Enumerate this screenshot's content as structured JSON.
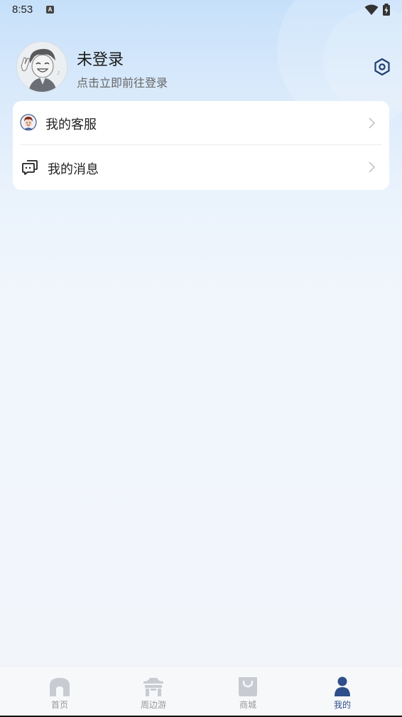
{
  "status_bar": {
    "time": "8:53",
    "notification_icon": "a-letter-icon",
    "wifi_icon": "wifi-icon",
    "battery_icon": "battery-charging-icon"
  },
  "profile": {
    "name": "未登录",
    "subtitle": "点击立即前往登录",
    "avatar_icon": "cartoon-avatar-icon",
    "settings_icon": "hexagon-settings-icon"
  },
  "menu": {
    "items": [
      {
        "label": "我的客服",
        "icon": "customer-service-avatar-icon"
      },
      {
        "label": "我的消息",
        "icon": "message-bubble-icon"
      }
    ]
  },
  "tabbar": {
    "items": [
      {
        "label": "首页",
        "icon": "home-icon",
        "active": false
      },
      {
        "label": "周边游",
        "icon": "pavilion-icon",
        "active": false
      },
      {
        "label": "商城",
        "icon": "shopping-bag-icon",
        "active": false
      },
      {
        "label": "我的",
        "icon": "person-icon",
        "active": true
      }
    ]
  },
  "colors": {
    "accent": "#2e4f8a",
    "inactive": "#c8ccd2",
    "header_gradient_top": "#c6e0fa",
    "background": "#f1f6fc"
  }
}
